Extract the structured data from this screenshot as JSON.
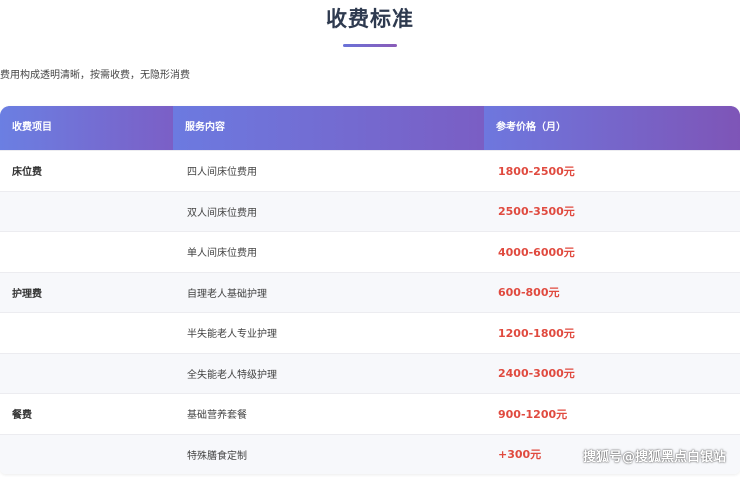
{
  "header": {
    "title": "收费标准",
    "subtitle": "费用构成透明清晰，按需收费，无隐形消费"
  },
  "table": {
    "columns": [
      "收费项目",
      "服务内容",
      "参考价格（月）"
    ],
    "rows": [
      {
        "category": "床位费",
        "service": "四人间床位费用",
        "price": "1800-2500元"
      },
      {
        "category": "",
        "service": "双人间床位费用",
        "price": "2500-3500元"
      },
      {
        "category": "",
        "service": "单人间床位费用",
        "price": "4000-6000元"
      },
      {
        "category": "护理费",
        "service": "自理老人基础护理",
        "price": "600-800元"
      },
      {
        "category": "",
        "service": "半失能老人专业护理",
        "price": "1200-1800元"
      },
      {
        "category": "",
        "service": "全失能老人特级护理",
        "price": "2400-3000元"
      },
      {
        "category": "餐费",
        "service": "基础营养套餐",
        "price": "900-1200元"
      },
      {
        "category": "",
        "service": "特殊膳食定制",
        "price": "+300元"
      }
    ]
  },
  "watermark": "搜狐号@搜狐黑点白银站",
  "colors": {
    "accent_start": "#6a7be0",
    "accent_end": "#7f56b8",
    "price": "#e04a3f",
    "title": "#2e3a4f"
  }
}
